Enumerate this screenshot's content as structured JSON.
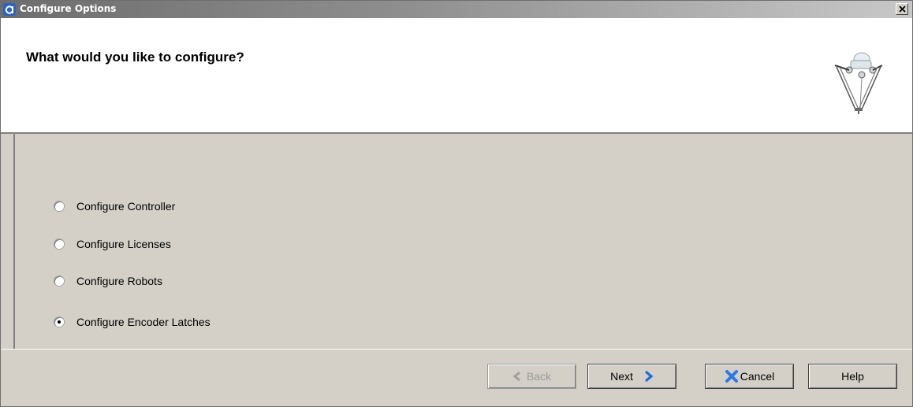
{
  "window": {
    "title": "Configure Options"
  },
  "header": {
    "title": "What would you like to configure?"
  },
  "options": [
    {
      "label": "Configure Controller",
      "checked": false
    },
    {
      "label": "Configure Licenses",
      "checked": false
    },
    {
      "label": "Configure Robots",
      "checked": false
    },
    {
      "label": "Configure Encoder Latches",
      "checked": true
    }
  ],
  "footer": {
    "back_label": "Back",
    "next_label": "Next",
    "cancel_label": "Cancel",
    "help_label": "Help"
  },
  "icons": {
    "app": "app-logo-icon",
    "close": "close-icon",
    "robot": "delta-robot-icon",
    "back": "back-arrow-icon",
    "next": "next-arrow-icon",
    "cancel": "cancel-x-icon"
  },
  "colors": {
    "dialog_bg": "#d4d0c8",
    "header_bg": "#ffffff",
    "next_arrow": "#1e6fd9",
    "cancel_x": "#2a7be4"
  }
}
